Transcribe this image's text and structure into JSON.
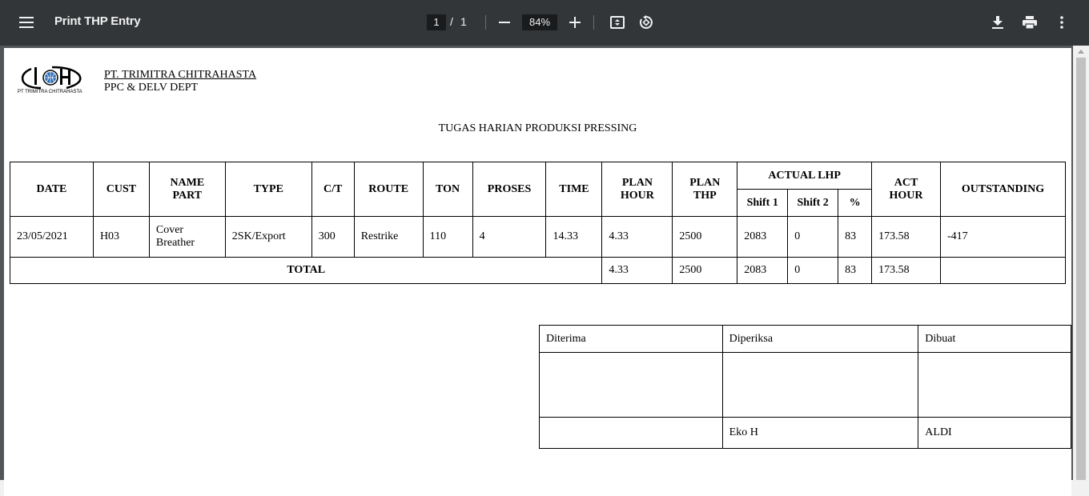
{
  "toolbar": {
    "title": "Print THP Entry",
    "page_current": "1",
    "page_sep": "/",
    "page_total": "1",
    "zoom": "84%"
  },
  "header": {
    "logo_caption": "PT TRIMITRA CHITRAHASTA",
    "company": "PT. TRIMITRA CHITRAHASTA",
    "dept": "PPC & DELV DEPT",
    "title": "TUGAS HARIAN PRODUKSI PRESSING"
  },
  "table": {
    "headers": {
      "date": "DATE",
      "cust": "CUST",
      "name_part_1": "NAME",
      "name_part_2": "PART",
      "type": "TYPE",
      "ct": "C/T",
      "route": "ROUTE",
      "ton": "TON",
      "proses": "PROSES",
      "time": "TIME",
      "plan_hour_1": "PLAN",
      "plan_hour_2": "HOUR",
      "plan_thp_1": "PLAN",
      "plan_thp_2": "THP",
      "actual_lhp": "ACTUAL LHP",
      "shift1": "Shift 1",
      "shift2": "Shift 2",
      "pct": "%",
      "act_hour_1": "ACT",
      "act_hour_2": "HOUR",
      "outstanding": "OUTSTANDING"
    },
    "rows": [
      {
        "date": "23/05/2021",
        "cust": "H03",
        "name_part_1": "Cover",
        "name_part_2": "Breather",
        "type": "2SK/Export",
        "ct": "300",
        "route": "Restrike",
        "ton": "110",
        "proses": "4",
        "time": "14.33",
        "plan_hour": "4.33",
        "plan_thp": "2500",
        "shift1": "2083",
        "shift2": "0",
        "pct": "83",
        "act_hour": "173.58",
        "outstanding": "-417"
      }
    ],
    "total": {
      "label": "TOTAL",
      "plan_hour": "4.33",
      "plan_thp": "2500",
      "shift1": "2083",
      "shift2": "0",
      "pct": "83",
      "act_hour": "173.58",
      "outstanding": ""
    }
  },
  "signatures": {
    "diterima": "Diterima",
    "diperiksa": "Diperiksa",
    "dibuat": "Dibuat",
    "diterima_name": "",
    "diperiksa_name": "Eko H",
    "dibuat_name": "ALDI"
  },
  "icons": [
    "menu-icon",
    "zoom-out-icon",
    "zoom-in-icon",
    "fit-page-icon",
    "rotate-icon",
    "download-icon",
    "print-icon",
    "more-vert-icon"
  ]
}
